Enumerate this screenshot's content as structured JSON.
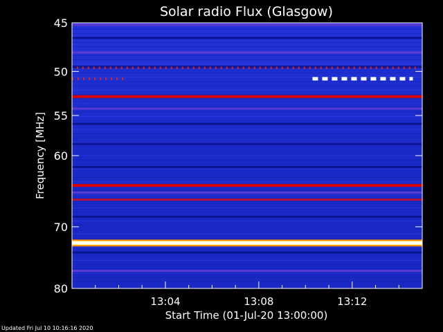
{
  "chart_data": {
    "type": "heatmap",
    "title": "Solar radio Flux (Glasgow)",
    "xlabel": "Start Time (01-Jul-20 13:00:00)",
    "ylabel": "Frequency [MHz]",
    "x_range_minutes": [
      0,
      15
    ],
    "y_range_mhz": [
      45,
      80
    ],
    "y_log_scale": true,
    "x_ticks": [
      {
        "label": "13:04",
        "minute": 4
      },
      {
        "label": "13:08",
        "minute": 8
      },
      {
        "label": "13:12",
        "minute": 12
      }
    ],
    "y_ticks": [
      {
        "label": "45",
        "value": 45
      },
      {
        "label": "50",
        "value": 50
      },
      {
        "label": "55",
        "value": 55
      },
      {
        "label": "60",
        "value": 60
      },
      {
        "label": "70",
        "value": 70
      },
      {
        "label": "80",
        "value": 80
      }
    ],
    "bands": [
      {
        "mhz": 45.2,
        "level": 0.55
      },
      {
        "mhz": 46.5,
        "level": 0.2
      },
      {
        "mhz": 48.0,
        "level": 0.45
      },
      {
        "mhz": 49.5,
        "level": 0.3
      },
      {
        "mhz": 52.8,
        "level": 0.85
      },
      {
        "mhz": 54.2,
        "level": 0.45
      },
      {
        "mhz": 56.0,
        "level": 0.2
      },
      {
        "mhz": 58.5,
        "level": 0.25
      },
      {
        "mhz": 61.5,
        "level": 0.35
      },
      {
        "mhz": 64.0,
        "level": 0.9
      },
      {
        "mhz": 65.0,
        "level": 0.5
      },
      {
        "mhz": 66.0,
        "level": 0.7
      },
      {
        "mhz": 68.5,
        "level": 0.25
      },
      {
        "mhz": 72.5,
        "level": 1.0
      },
      {
        "mhz": 74.0,
        "level": 0.35
      },
      {
        "mhz": 77.0,
        "level": 0.5
      }
    ],
    "bursts": [
      {
        "mhz": 49.6,
        "start_min": 0.2,
        "end_min": 14.8,
        "style": "dotted-red"
      },
      {
        "mhz": 50.8,
        "start_min": 0.0,
        "end_min": 2.2,
        "style": "dotted-red"
      },
      {
        "mhz": 50.8,
        "start_min": 10.3,
        "end_min": 14.6,
        "style": "dashed-white"
      }
    ],
    "colors": {
      "background": "#000000",
      "low": "#1a2ad0",
      "mid": "#cc0000",
      "high": "#ffffff"
    }
  },
  "footer": {
    "updated": "Updated Fri Jul 10 10:16:16 2020"
  }
}
